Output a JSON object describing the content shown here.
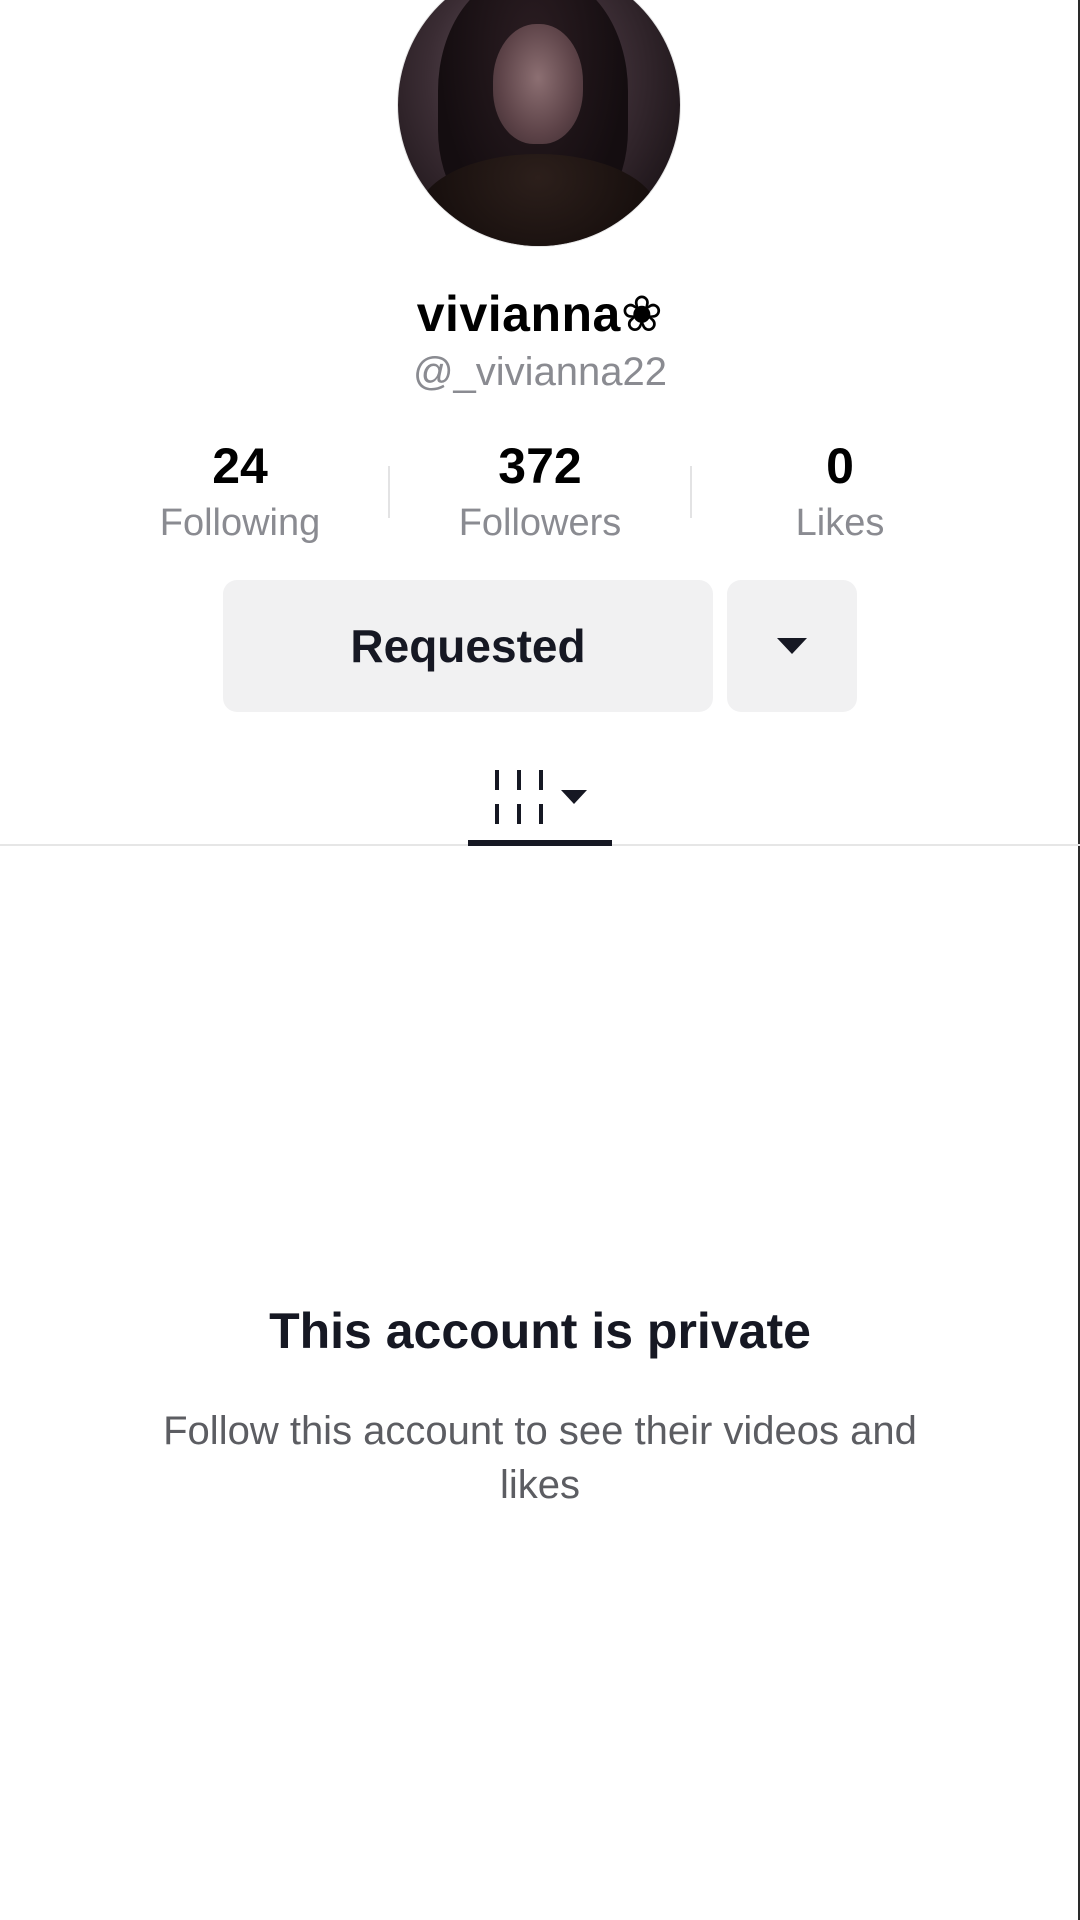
{
  "profile": {
    "display_name": "vivianna❀",
    "username": "@_vivianna22"
  },
  "stats": {
    "following": {
      "count": "24",
      "label": "Following"
    },
    "followers": {
      "count": "372",
      "label": "Followers"
    },
    "likes": {
      "count": "0",
      "label": "Likes"
    }
  },
  "actions": {
    "requested_label": "Requested"
  },
  "icons": {
    "more": "caret-down-icon",
    "videos_tab": "grid-icon"
  },
  "private_notice": {
    "title": "This account is private",
    "subtitle": "Follow this account to see their videos and likes"
  },
  "colors": {
    "text_primary": "#161823",
    "text_secondary": "#8a8b91",
    "button_bg": "#f1f1f2"
  }
}
